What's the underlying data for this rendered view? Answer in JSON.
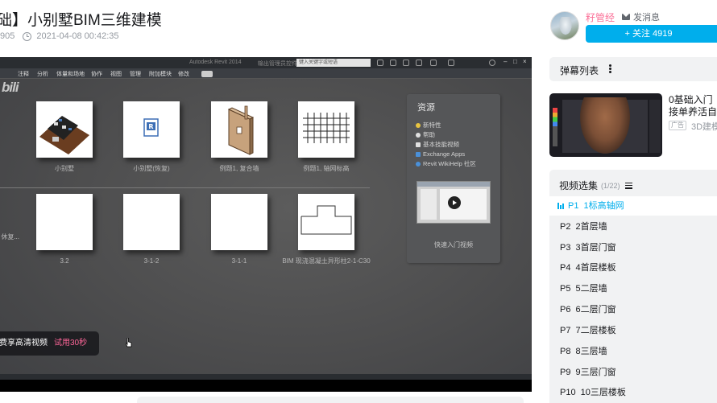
{
  "video": {
    "title": "础】小别墅BIM三维建模",
    "views_fragment": "905",
    "date": "2021-04-08 00:42:35"
  },
  "player": {
    "app_titlebar": {
      "window_title": "Autodesk Revit 2014",
      "subtitle": "输出管理员控件",
      "search_placeholder": "键入关键字或短语"
    },
    "ribbon_tabs": [
      "注释",
      "分析",
      "体量和场地",
      "协作",
      "视图",
      "管理",
      "附加模块",
      "修改"
    ],
    "logo_fragment": "bili",
    "recent_projects": [
      {
        "label": "小别墅"
      },
      {
        "label": "小别墅(恢复)"
      },
      {
        "label": "例题1, 复合墙"
      },
      {
        "label": "例题1, 轴网标高"
      }
    ],
    "recent_families": [
      {
        "label": "3.2"
      },
      {
        "label": "3-1-2"
      },
      {
        "label": "3-1-1"
      },
      {
        "label": "BIM 现浇混凝土异形柱2-1-C30"
      }
    ],
    "left_edge_label": "休复...",
    "resources": {
      "title": "资源",
      "items": [
        {
          "label": "新特性",
          "icon": "star-icon",
          "color": "#e8c440"
        },
        {
          "label": "帮助",
          "icon": "help-icon",
          "color": "#e0e0e0"
        },
        {
          "label": "基本技能视频",
          "icon": "video-icon",
          "color": "#e0e0e0"
        },
        {
          "label": "Exchange Apps",
          "icon": "exchange-icon",
          "color": "#4a90d9"
        },
        {
          "label": "Revit WikiHelp 社区",
          "icon": "community-icon",
          "color": "#4a90d9"
        }
      ],
      "video_caption": "快速入门视频"
    },
    "hd_banner": {
      "main": "费享高清视频",
      "trial": "试用30秒"
    }
  },
  "uploader": {
    "name": "籽管经",
    "message_label": "发消息",
    "follow_label": "+ 关注 4919"
  },
  "danmaku": {
    "label": "弹幕列表"
  },
  "ad": {
    "title_line1": "0基础入门",
    "title_line2": "接单养活自",
    "tag": "广告",
    "sub": "3D建模"
  },
  "playlist": {
    "title": "视频选集",
    "count": "(1/22)",
    "episodes": [
      {
        "code": "P1",
        "title": "1标高轴网",
        "active": true
      },
      {
        "code": "P2",
        "title": "2首层墙",
        "active": false
      },
      {
        "code": "P3",
        "title": "3首层门窗",
        "active": false
      },
      {
        "code": "P4",
        "title": "4首层楼板",
        "active": false
      },
      {
        "code": "P5",
        "title": "5二层墙",
        "active": false
      },
      {
        "code": "P6",
        "title": "6二层门窗",
        "active": false
      },
      {
        "code": "P7",
        "title": "7二层楼板",
        "active": false
      },
      {
        "code": "P8",
        "title": "8三层墙",
        "active": false
      },
      {
        "code": "P9",
        "title": "9三层门窗",
        "active": false
      },
      {
        "code": "P10",
        "title": "10三层楼板",
        "active": false
      }
    ]
  },
  "colors": {
    "accent": "#00aeec",
    "uploader_name": "#fb7299",
    "trial": "#ff6699"
  }
}
